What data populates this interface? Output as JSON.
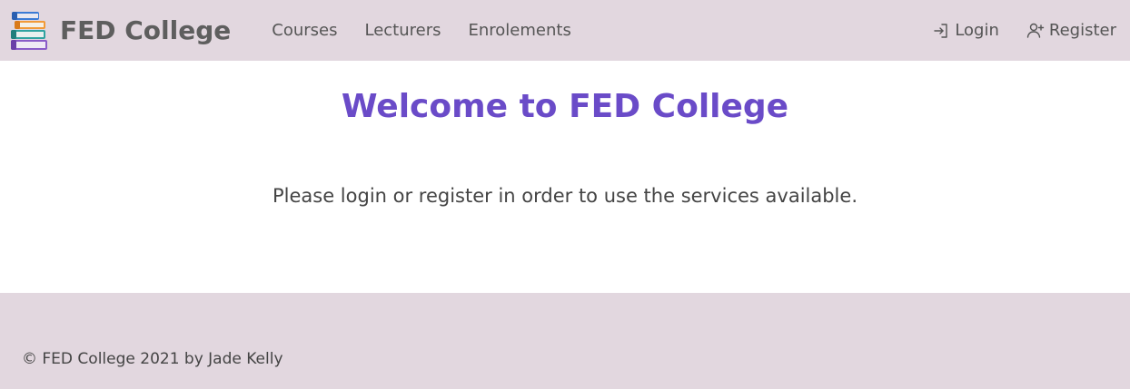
{
  "navbar": {
    "brand": {
      "title": "FED College",
      "logo_icon": "books-icon"
    },
    "links": [
      {
        "label": "Courses"
      },
      {
        "label": "Lecturers"
      },
      {
        "label": "Enrolements"
      }
    ],
    "right": [
      {
        "label": "Login",
        "icon": "login-icon"
      },
      {
        "label": "Register",
        "icon": "add-user-icon"
      }
    ]
  },
  "main": {
    "heading": "Welcome to FED College",
    "message": "Please login or register in order to use the services available."
  },
  "footer": {
    "text": "© FED College 2021 by Jade Kelly"
  },
  "colors": {
    "navbar_bg": "#e2d7df",
    "heading": "#6a4bc8",
    "text": "#444444"
  }
}
